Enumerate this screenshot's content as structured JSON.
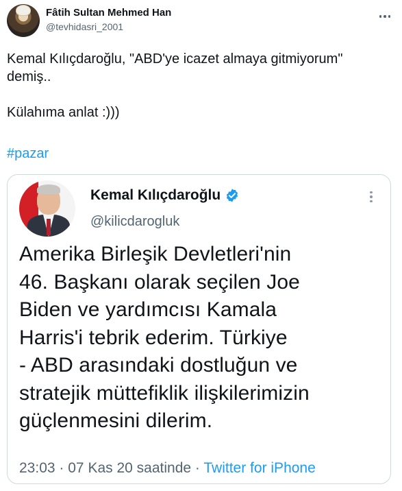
{
  "tweet": {
    "author_name": "Fâtih Sultan Mehmed Han",
    "author_handle": "@tevhidasri_2001",
    "text": "Kemal Kılıçdaroğlu, \"ABD'ye icazet almaya gitmiyorum\"\ndemiş..\n\nKülahıma anlat :)))",
    "hashtag": "#pazar"
  },
  "quoted": {
    "author_name": "Kemal Kılıçdaroğlu",
    "author_handle": "@kilicdarogluk",
    "verified": true,
    "lines": [
      "Amerika Birleşik Devletleri'nin",
      "46. Başkanı olarak seçilen Joe",
      "Biden ve yardımcısı Kamala",
      "Harris'i tebrik ederim. Türkiye",
      "- ABD arasındaki dostluğun ve",
      "stratejik müttefiklik ilişkilerimizin",
      "güçlenmesini dilerim."
    ],
    "time": "23:03",
    "date": "07 Kas 20 saatinde",
    "separator": "·",
    "source": "Twitter for iPhone"
  },
  "colors": {
    "accent": "#1d9bf0",
    "secondary_text": "#536471",
    "border": "#cfd9de"
  },
  "icons": {
    "more_options": "more-horizontal-icon",
    "quoted_more": "more-vertical-icon",
    "verified": "verified-badge-icon"
  }
}
